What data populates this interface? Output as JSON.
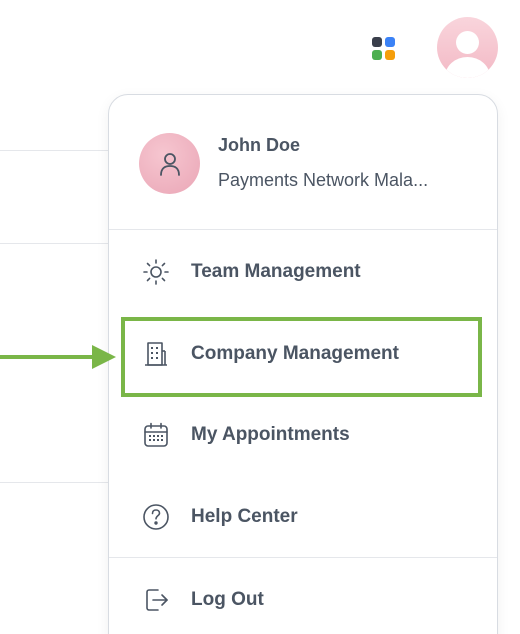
{
  "header": {
    "apps_icon": "grid-apps-icon",
    "apps_colors": [
      "#3a3f4b",
      "#3b82f6",
      "#4caf50",
      "#f59e0b"
    ],
    "avatar_icon": "user-avatar-icon"
  },
  "profile": {
    "name": "John Doe",
    "company": "Payments Network Mala...",
    "avatar_icon": "user-icon"
  },
  "menu": {
    "items": [
      {
        "label": "Team Management",
        "icon": "sun-icon"
      },
      {
        "label": "Company Management",
        "icon": "building-icon"
      },
      {
        "label": "My Appointments",
        "icon": "calendar-icon"
      },
      {
        "label": "Help Center",
        "icon": "help-circle-icon"
      }
    ],
    "logout": {
      "label": "Log Out",
      "icon": "logout-icon"
    }
  },
  "annotation": {
    "highlight_color": "#7ab648",
    "highlighted_item": "Company Management"
  }
}
